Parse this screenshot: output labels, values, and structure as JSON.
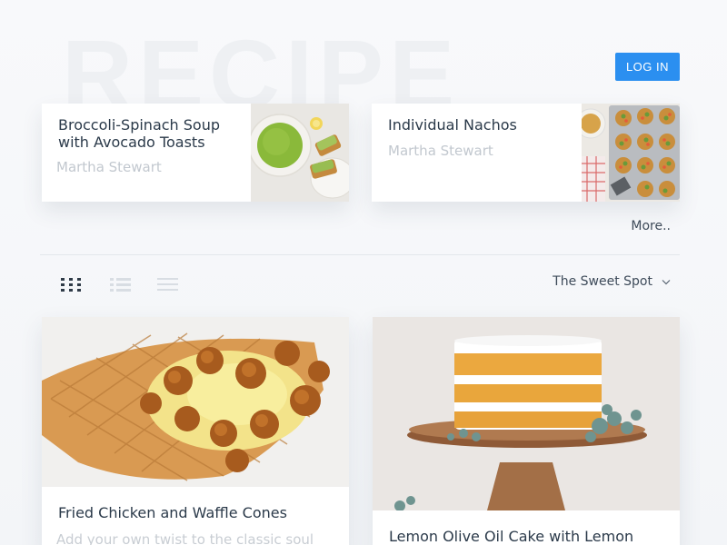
{
  "header": {
    "watermark": "RECIPE",
    "login_label": "LOG IN"
  },
  "featured": [
    {
      "title": "Broccoli-Spinach Soup with Avocado Toasts",
      "author": "Martha Stewart"
    },
    {
      "title": "Individual Nachos",
      "author": "Martha Stewart"
    }
  ],
  "more_label": "More..",
  "toolbar": {
    "views": [
      "grid-view-icon",
      "list-view-icon",
      "compact-view-icon"
    ],
    "sort_value": "The Sweet Spot"
  },
  "recipes": [
    {
      "title": "Fried Chicken and Waffle Cones",
      "description": "Add your own twist to the classic soul"
    },
    {
      "title": "Lemon Olive Oil Cake with Lemon"
    }
  ],
  "colors": {
    "accent": "#2b8ff0",
    "text": "#2b3a4a",
    "muted": "#c2c8cf"
  }
}
